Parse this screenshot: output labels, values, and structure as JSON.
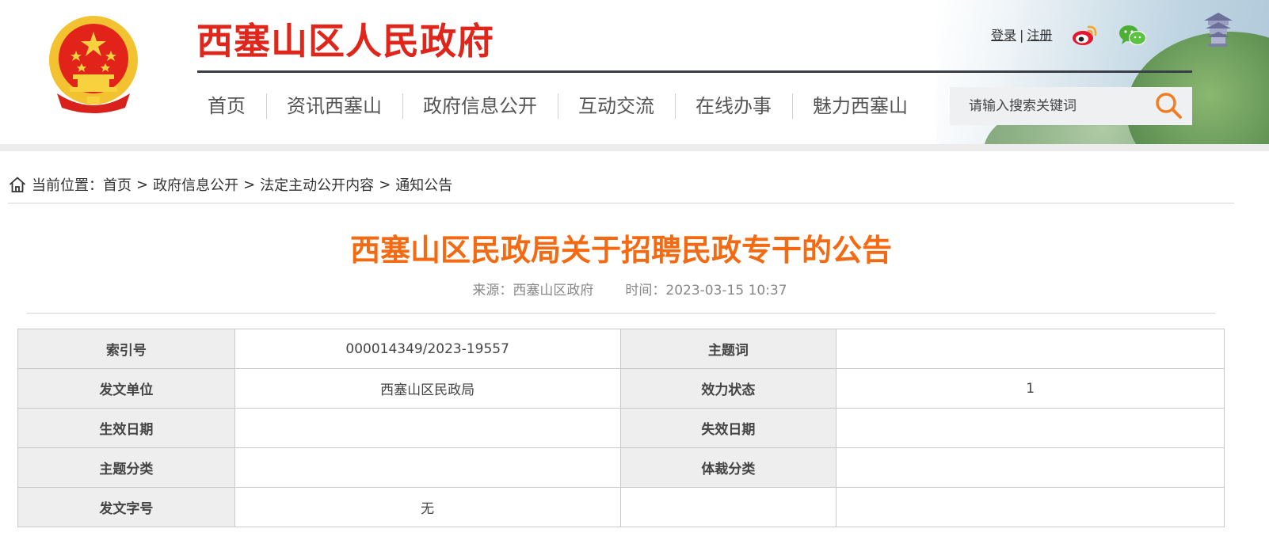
{
  "header": {
    "site_title": "西塞山区人民政府",
    "login_label": "登录",
    "separator": "|",
    "register_label": "注册",
    "nav": [
      {
        "label": "首页"
      },
      {
        "label": "资讯西塞山"
      },
      {
        "label": "政府信息公开"
      },
      {
        "label": "互动交流"
      },
      {
        "label": "在线办事"
      },
      {
        "label": "魅力西塞山"
      }
    ],
    "search": {
      "placeholder": "请输入搜索关键词",
      "value": ""
    },
    "icons": {
      "emblem": "national-emblem",
      "weibo": "weibo-icon",
      "wechat": "wechat-icon",
      "search": "search-icon"
    }
  },
  "breadcrumb": {
    "prefix": "当前位置：",
    "items": [
      "首页",
      "政府信息公开",
      "法定主动公开内容",
      "通知公告"
    ],
    "separator": ">"
  },
  "article": {
    "title": "西塞山区民政局关于招聘民政专干的公告",
    "source": "来源：西塞山区政府",
    "time": "时间：2023-03-15 10:37"
  },
  "info_table": {
    "rows": [
      {
        "label1": "索引号",
        "value1": "000014349/2023-19557",
        "label2": "主题词",
        "value2": ""
      },
      {
        "label1": "发文单位",
        "value1": "西塞山区民政局",
        "label2": "效力状态",
        "value2": "1"
      },
      {
        "label1": "生效日期",
        "value1": "",
        "label2": "失效日期",
        "value2": ""
      },
      {
        "label1": "主题分类",
        "value1": "",
        "label2": "体裁分类",
        "value2": ""
      },
      {
        "label1": "发文字号",
        "value1": "无",
        "label2": "",
        "value2": ""
      }
    ]
  },
  "colors": {
    "brand_red": "#e0261b",
    "title_orange": "#f46a12",
    "search_orange": "#f47b20"
  }
}
